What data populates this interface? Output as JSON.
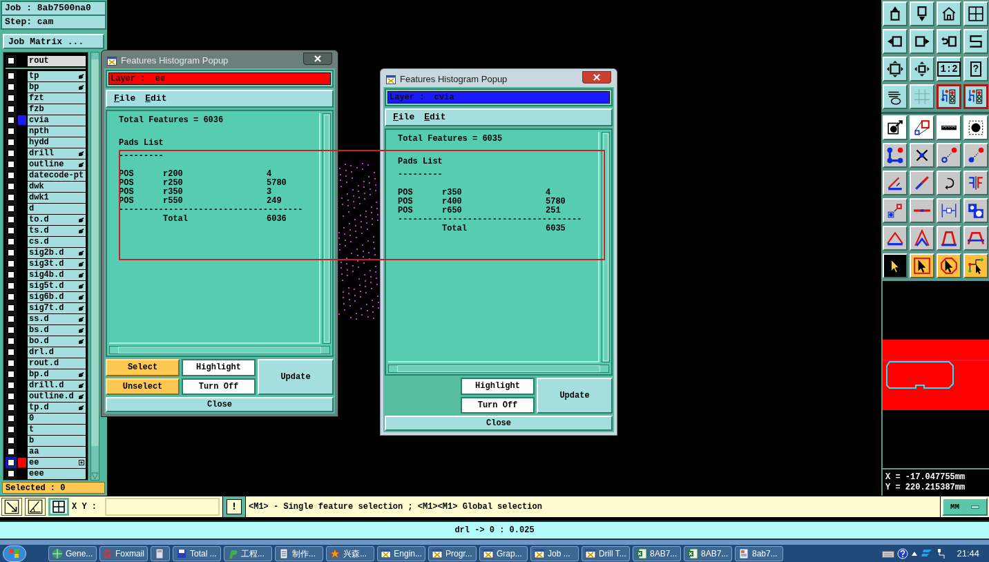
{
  "job_panel": {
    "job": "Job : 8ab7500na0",
    "step": "Step: cam",
    "matrix_button": "Job Matrix ..."
  },
  "layers": [
    {
      "name": "rout",
      "checked": false,
      "selected": true,
      "active": false,
      "kind": "plain"
    },
    {
      "name": "tp",
      "checked": false,
      "selected": false,
      "active": false,
      "kind": "hand"
    },
    {
      "name": "bp",
      "checked": false,
      "selected": false,
      "active": false,
      "kind": "hand"
    },
    {
      "name": "fzt",
      "checked": false,
      "selected": false,
      "active": false,
      "kind": "plain"
    },
    {
      "name": "fzb",
      "checked": false,
      "selected": false,
      "active": false,
      "kind": "plain"
    },
    {
      "name": "cvia",
      "checked": false,
      "selected": false,
      "active": false,
      "kind": "plain",
      "color": "#1a1aff"
    },
    {
      "name": "npth",
      "checked": false,
      "selected": false,
      "active": false,
      "kind": "plain"
    },
    {
      "name": "hydd",
      "checked": false,
      "selected": false,
      "active": false,
      "kind": "plain"
    },
    {
      "name": "drill",
      "checked": false,
      "selected": false,
      "active": false,
      "kind": "hand"
    },
    {
      "name": "outline",
      "checked": false,
      "selected": false,
      "active": false,
      "kind": "hand"
    },
    {
      "name": "datecode-pt",
      "checked": false,
      "selected": false,
      "active": false,
      "kind": "plain"
    },
    {
      "name": "dwk",
      "checked": false,
      "selected": false,
      "active": false,
      "kind": "plain"
    },
    {
      "name": "dwk1",
      "checked": false,
      "selected": false,
      "active": false,
      "kind": "plain"
    },
    {
      "name": "d",
      "checked": false,
      "selected": false,
      "active": false,
      "kind": "plain"
    },
    {
      "name": "to.d",
      "checked": false,
      "selected": false,
      "active": false,
      "kind": "hand"
    },
    {
      "name": "ts.d",
      "checked": false,
      "selected": false,
      "active": false,
      "kind": "hand"
    },
    {
      "name": "cs.d",
      "checked": false,
      "selected": false,
      "active": false,
      "kind": "plain"
    },
    {
      "name": "sig2b.d",
      "checked": false,
      "selected": false,
      "active": false,
      "kind": "hand"
    },
    {
      "name": "sig3t.d",
      "checked": false,
      "selected": false,
      "active": false,
      "kind": "hand"
    },
    {
      "name": "sig4b.d",
      "checked": false,
      "selected": false,
      "active": false,
      "kind": "hand"
    },
    {
      "name": "sig5t.d",
      "checked": false,
      "selected": false,
      "active": false,
      "kind": "hand"
    },
    {
      "name": "sig6b.d",
      "checked": false,
      "selected": false,
      "active": false,
      "kind": "hand"
    },
    {
      "name": "sig7t.d",
      "checked": false,
      "selected": false,
      "active": false,
      "kind": "hand"
    },
    {
      "name": "ss.d",
      "checked": false,
      "selected": false,
      "active": false,
      "kind": "hand"
    },
    {
      "name": "bs.d",
      "checked": false,
      "selected": false,
      "active": false,
      "kind": "hand"
    },
    {
      "name": "bo.d",
      "checked": false,
      "selected": false,
      "active": false,
      "kind": "hand"
    },
    {
      "name": "drl.d",
      "checked": false,
      "selected": false,
      "active": false,
      "kind": "plain"
    },
    {
      "name": "rout.d",
      "checked": false,
      "selected": false,
      "active": false,
      "kind": "plain"
    },
    {
      "name": "bp.d",
      "checked": false,
      "selected": false,
      "active": false,
      "kind": "hand"
    },
    {
      "name": "drill.d",
      "checked": false,
      "selected": false,
      "active": false,
      "kind": "hand"
    },
    {
      "name": "outline.d",
      "checked": false,
      "selected": false,
      "active": false,
      "kind": "hand"
    },
    {
      "name": "tp.d",
      "checked": false,
      "selected": false,
      "active": false,
      "kind": "hand"
    },
    {
      "name": "0",
      "checked": false,
      "selected": false,
      "active": false,
      "kind": "plain"
    },
    {
      "name": "t",
      "checked": false,
      "selected": false,
      "active": false,
      "kind": "plain"
    },
    {
      "name": "b",
      "checked": false,
      "selected": false,
      "active": false,
      "kind": "plain"
    },
    {
      "name": "aa",
      "checked": false,
      "selected": false,
      "active": false,
      "kind": "plain"
    },
    {
      "name": "ee",
      "checked": false,
      "selected": false,
      "active": true,
      "kind": "plus",
      "color": "#ff0000"
    },
    {
      "name": "eee",
      "checked": false,
      "selected": false,
      "active": false,
      "kind": "plain"
    }
  ],
  "selected_count": "Selected : 0",
  "popups": [
    {
      "title": "Features Histogram Popup",
      "focused": true,
      "layer": {
        "label": "Layer :  ee",
        "color": "#ff0000"
      },
      "menu": [
        "File",
        "Edit"
      ],
      "report": {
        "total_line": "Total Features = 6036",
        "section": "Pads List",
        "underline": "---------",
        "rows": [
          {
            "type": "POS",
            "symbol": "r200",
            "count": "4"
          },
          {
            "type": "POS",
            "symbol": "r250",
            "count": "5780"
          },
          {
            "type": "POS",
            "symbol": "r350",
            "count": "3"
          },
          {
            "type": "POS",
            "symbol": "r550",
            "count": "249"
          }
        ],
        "separator": "-------------------------------------",
        "total_label": "Total",
        "total_value": "6036"
      },
      "select_buttons": [
        "Select",
        "Unselect"
      ],
      "view_buttons": [
        "Highlight",
        "Turn Off"
      ],
      "update_button": "Update",
      "close_button": "Close"
    },
    {
      "title": "Features Histogram Popup",
      "focused": false,
      "layer": {
        "label": "Layer :  cvia",
        "color": "#1a1aff"
      },
      "menu": [
        "File",
        "Edit"
      ],
      "report": {
        "total_line": "Total Features = 6035",
        "section": "Pads List",
        "underline": "---------",
        "rows": [
          {
            "type": "POS",
            "symbol": "r350",
            "count": "4"
          },
          {
            "type": "POS",
            "symbol": "r400",
            "count": "5780"
          },
          {
            "type": "POS",
            "symbol": "r650",
            "count": "251"
          }
        ],
        "separator": "-------------------------------------",
        "total_label": "Total",
        "total_value": "6035"
      },
      "view_buttons": [
        "Highlight",
        "Turn Off"
      ],
      "update_button": "Update",
      "close_button": "Close"
    }
  ],
  "tools": [
    {
      "kind": "box-up",
      "active": false,
      "selected": false
    },
    {
      "kind": "box-down",
      "active": false,
      "selected": false
    },
    {
      "kind": "house",
      "active": false,
      "selected": false
    },
    {
      "kind": "window-grid",
      "active": false,
      "selected": false
    },
    {
      "kind": "box-left",
      "active": false,
      "selected": false
    },
    {
      "kind": "box-right",
      "active": false,
      "selected": false
    },
    {
      "kind": "undo-box",
      "active": false,
      "selected": false
    },
    {
      "kind": "zigzag",
      "active": false,
      "selected": false
    },
    {
      "kind": "zoom-fit",
      "active": false,
      "selected": false
    },
    {
      "kind": "zoom-center",
      "active": false,
      "selected": false
    },
    {
      "kind": "text",
      "active": false,
      "selected": false,
      "label": "1:2"
    },
    {
      "kind": "text",
      "active": false,
      "selected": false,
      "label": "?"
    },
    {
      "kind": "tools-palette",
      "active": false,
      "selected": false
    },
    {
      "kind": "grid",
      "active": false,
      "selected": false
    },
    {
      "kind": "board-lights",
      "active": true,
      "selected": false
    },
    {
      "kind": "board-lights",
      "active": true,
      "selected": false
    },
    {
      "kind": "pointer-dot",
      "active": false,
      "selected": false
    },
    {
      "kind": "copy-shape",
      "active": false,
      "selected": false
    },
    {
      "kind": "ruler",
      "active": false,
      "selected": false
    },
    {
      "kind": "dot-frame",
      "active": false,
      "selected": false
    },
    {
      "kind": "nodes",
      "active": false,
      "selected": false
    },
    {
      "kind": "cross",
      "active": false,
      "selected": false
    },
    {
      "kind": "dot-link-ring",
      "active": false,
      "selected": false
    },
    {
      "kind": "dot-link",
      "active": false,
      "selected": false
    },
    {
      "kind": "angle",
      "active": false,
      "selected": false
    },
    {
      "kind": "diagonal",
      "active": false,
      "selected": false
    },
    {
      "kind": "rotate",
      "active": false,
      "selected": false
    },
    {
      "kind": "mirror",
      "active": false,
      "selected": false
    },
    {
      "kind": "square-link",
      "active": false,
      "selected": false
    },
    {
      "kind": "dash",
      "active": false,
      "selected": false
    },
    {
      "kind": "dimension",
      "active": false,
      "selected": false
    },
    {
      "kind": "overlap",
      "active": false,
      "selected": false
    },
    {
      "kind": "triangle",
      "active": false,
      "selected": false
    },
    {
      "kind": "peak",
      "active": false,
      "selected": false
    },
    {
      "kind": "arch",
      "active": false,
      "selected": false
    },
    {
      "kind": "arch-wide",
      "active": false,
      "selected": false
    },
    {
      "kind": "pointer",
      "active": false,
      "selected": true
    },
    {
      "kind": "pointer-frame",
      "active": false,
      "selected": false
    },
    {
      "kind": "pointer-octagon",
      "active": false,
      "selected": false
    },
    {
      "kind": "path-pointer",
      "active": false,
      "selected": false
    }
  ],
  "coordinates": {
    "x": "X = -17.047755mm",
    "y": "Y = 220.215387mm"
  },
  "command_bar": {
    "tools": [
      {
        "kind": "diagonal-resize",
        "selected": false
      },
      {
        "kind": "angle-measure",
        "selected": false
      },
      {
        "kind": "grid-snap",
        "selected": true
      }
    ],
    "xy_label": "X Y :",
    "alert_button": "!",
    "prompt": "<M1> - Single feature selection ; <M1><M1> Global selection",
    "units": "MM"
  },
  "status_bar": "drl -> 0 : 0.025",
  "taskbar": {
    "items": [
      {
        "kind": "globe",
        "label": "Gene..."
      },
      {
        "kind": "mail",
        "label": "Foxmail"
      },
      {
        "kind": "calculator"
      },
      {
        "kind": "floppy",
        "label": "Total ..."
      },
      {
        "kind": "leaf",
        "label": "工程..."
      },
      {
        "kind": "document",
        "label": "制作..."
      },
      {
        "kind": "star",
        "label": "兴森..."
      },
      {
        "kind": "app-window",
        "label": "Engin..."
      },
      {
        "kind": "app-window",
        "label": "Progr..."
      },
      {
        "kind": "app-window",
        "label": "Grap..."
      },
      {
        "kind": "app-window",
        "label": "Job ..."
      },
      {
        "kind": "app-window",
        "label": "Drill T..."
      },
      {
        "kind": "spreadsheet",
        "label": "8AB7..."
      },
      {
        "kind": "spreadsheet",
        "label": "8AB7..."
      },
      {
        "kind": "page",
        "label": "8ab7..."
      }
    ],
    "clock": "21:44"
  }
}
